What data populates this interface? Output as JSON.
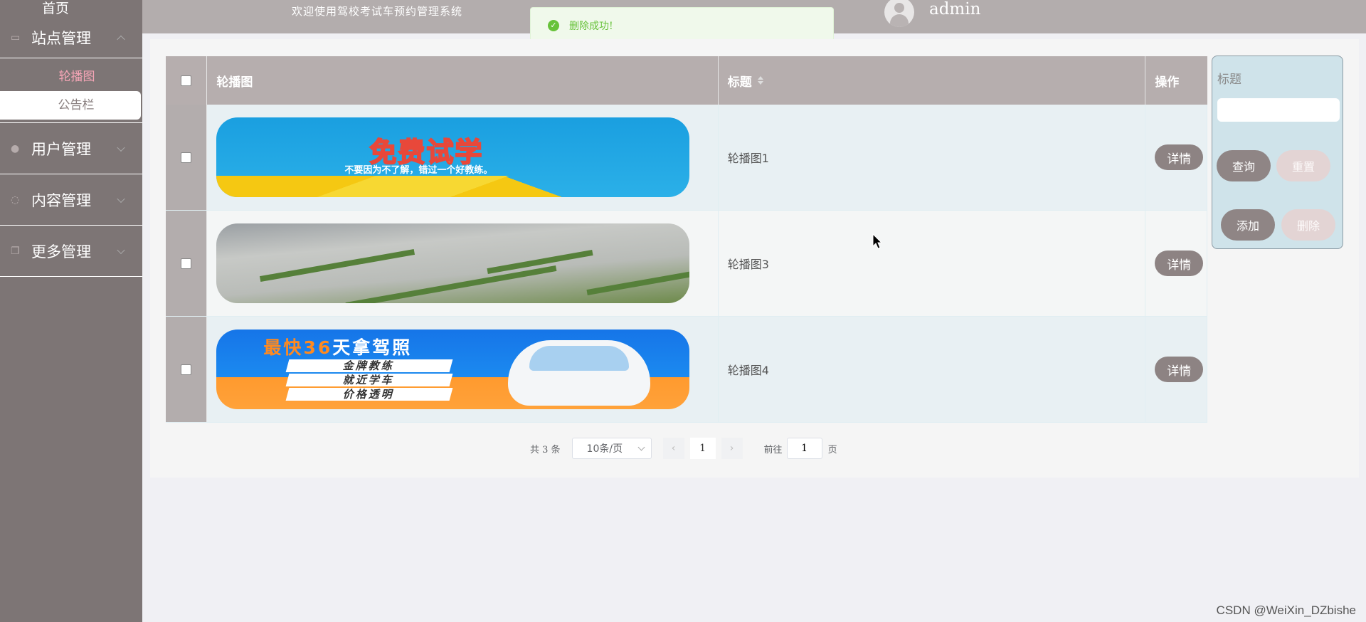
{
  "header": {
    "title": "欢迎使用驾校考试车预约管理系统",
    "username": "admin"
  },
  "toast": {
    "message": "删除成功!"
  },
  "sidebar": {
    "home": "首页",
    "groups": [
      {
        "label": "站点管理",
        "icon": "monitor-icon",
        "expanded": true
      },
      {
        "label": "用户管理",
        "icon": "user-icon",
        "expanded": false
      },
      {
        "label": "内容管理",
        "icon": "chat-icon",
        "expanded": false
      },
      {
        "label": "更多管理",
        "icon": "copy-icon",
        "expanded": false
      }
    ],
    "subitems": [
      "轮播图",
      "公告栏"
    ]
  },
  "table": {
    "columns": [
      "轮播图",
      "标题",
      "操作"
    ],
    "rows": [
      {
        "title": "轮播图1",
        "detail": "详情"
      },
      {
        "title": "轮播图3",
        "detail": "详情"
      },
      {
        "title": "轮播图4",
        "detail": "详情"
      }
    ],
    "banner1": {
      "headline": "免费试学",
      "sub": "不要因为不了解，错过一个好教练。"
    },
    "banner3": {
      "headline_a": "最快",
      "headline_num": "36",
      "headline_b": "天拿驾照",
      "tags": [
        "金牌教练",
        "就近学车",
        "价格透明"
      ]
    }
  },
  "search": {
    "label": "标题",
    "input_value": "",
    "query_label": "查询",
    "reset_label": "重置",
    "add_label": "添加",
    "delete_label": "删除"
  },
  "pager": {
    "total": "共 3 条",
    "page_size": "10条/页",
    "current_page": "1",
    "goto_label": "前往",
    "goto_value": "1",
    "page_unit": "页"
  },
  "watermark": "CSDN @WeiXin_DZbishe",
  "colors": {
    "sidebar": "#7d7575",
    "header": "#b3adad",
    "success": "#67c23a",
    "button": "#8d8383"
  }
}
